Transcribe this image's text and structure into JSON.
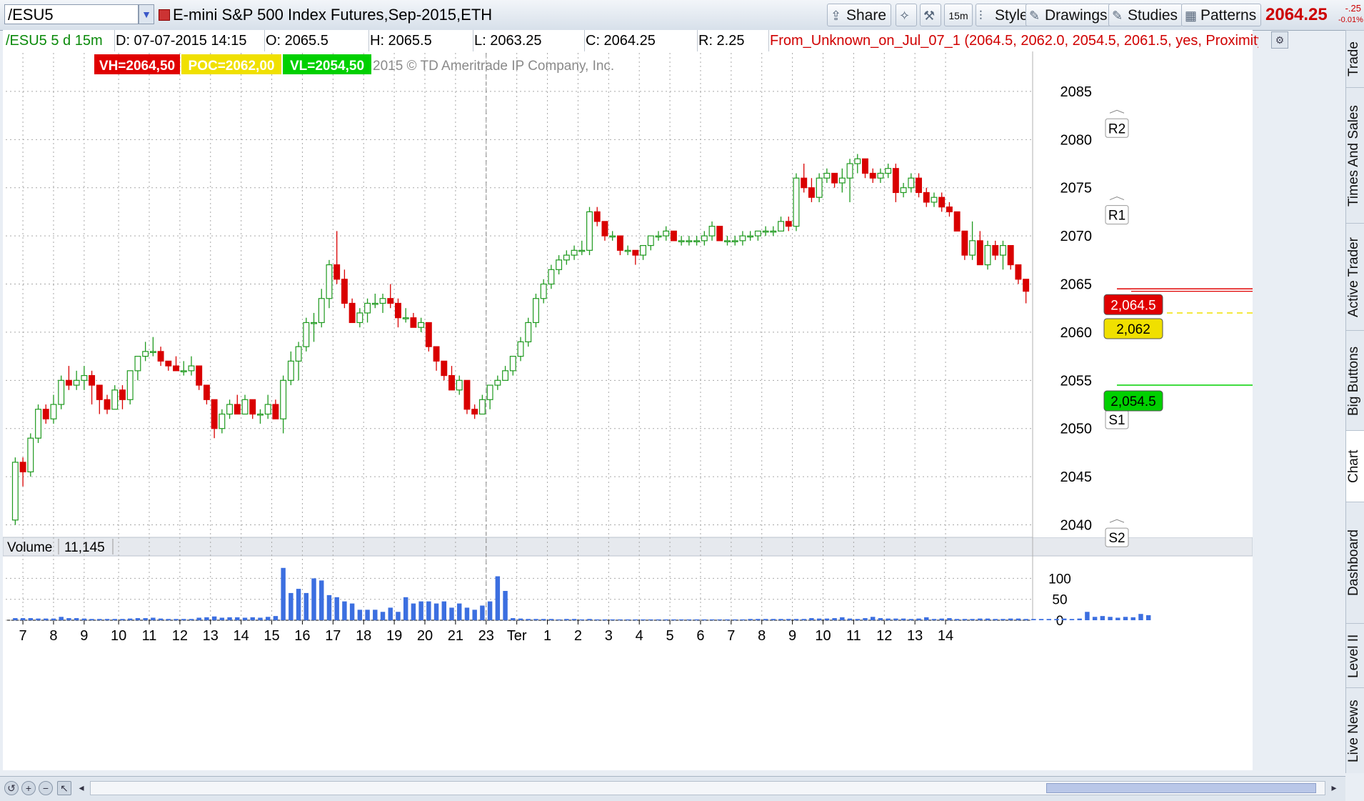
{
  "toolbar": {
    "symbol": "/ESU5",
    "title": "E-mini S&P 500 Index Futures,Sep-2015,ETH",
    "share": "Share",
    "timeframe": "15m",
    "style": "Style",
    "drawings": "Drawings",
    "studies": "Studies",
    "patterns": "Patterns",
    "last_price": "2064.25",
    "change": "-.25",
    "change_pct": "-0.01%"
  },
  "infobar": {
    "period": "/ESU5 5 d 15m",
    "date": "D: 07-07-2015 14:15",
    "open": "O: 2065.5",
    "high": "H: 2065.5",
    "low": "L: 2063.25",
    "close": "C: 2064.25",
    "range": "R: 2.25",
    "study": "From_Unknown_on_Jul_07_1 (2064.5, 2062.0, 2054.5, 2061.5, yes, Proximity, no, no, yes,..."
  },
  "overlay": {
    "vh": "VH=2064,50",
    "poc": "POC=2062,00",
    "vl": "VL=2054,50",
    "copyright": "2015 © TD Ameritrade IP Company, Inc."
  },
  "colors": {
    "up": "#1f9a1f",
    "down": "#d90000",
    "volume": "#3c6fe0",
    "vh": "#e00000",
    "poc": "#f0e000",
    "vl": "#00d000",
    "grid": "#a7a7a7"
  },
  "volume": {
    "label": "Volume",
    "value": "11,145",
    "unit": "<thousan..."
  },
  "sidetabs": [
    "Trade",
    "Times And Sales",
    "Active Trader",
    "Big Buttons",
    "Chart",
    "Dashboard",
    "Level II",
    "Live News"
  ],
  "chart_data": {
    "type": "candlestick",
    "ylim": [
      2039,
      2089
    ],
    "yticks": [
      2085,
      2080,
      2075,
      2070,
      2065,
      2060,
      2055,
      2050,
      2045,
      2040
    ],
    "price_marks": [
      {
        "label": "2082.75",
        "value": 2082.75,
        "color": "#ffffff",
        "text": "#000000"
      },
      {
        "label": "2073.75",
        "value": 2073.75,
        "color": "#ffffff",
        "text": "#000000"
      },
      {
        "label": "2064.25",
        "value": 2064.25,
        "color": "#e00000",
        "text": "#ffffff"
      },
      {
        "label": "2062",
        "value": 2062,
        "color": "#f0e000",
        "text": "#000000"
      },
      {
        "label": "2054.5",
        "value": 2054.5,
        "color": "#00d000",
        "text": "#000000"
      },
      {
        "label": "2052.5",
        "value": 2052.5,
        "color": "#ffffff",
        "text": "#000000"
      },
      {
        "label": "2040.25",
        "value": 2040.25,
        "color": "#ffffff",
        "text": "#000000"
      }
    ],
    "pivots": [
      {
        "label": "R2",
        "value": 2082.75
      },
      {
        "label": "R1",
        "value": 2073.75
      },
      {
        "label": "S1",
        "value": 2052.5
      },
      {
        "label": "S2",
        "value": 2040.25
      }
    ],
    "levels": [
      {
        "label": "2,064.5",
        "value": 2064.5,
        "color": "#e00000",
        "text": "#ffffff"
      },
      {
        "label": "2,062",
        "value": 2062,
        "color": "#f0e000",
        "text": "#000000"
      },
      {
        "label": "2,054.5",
        "value": 2054.5,
        "color": "#00d000",
        "text": "#000000"
      }
    ],
    "session_divider_index": 62,
    "x_labels": [
      {
        "label": "7",
        "index": 1
      },
      {
        "label": "8",
        "index": 5
      },
      {
        "label": "9",
        "index": 9
      },
      {
        "label": "10",
        "index": 13.5
      },
      {
        "label": "11",
        "index": 17.5
      },
      {
        "label": "12",
        "index": 21.5
      },
      {
        "label": "13",
        "index": 25.5
      },
      {
        "label": "14",
        "index": 29.5
      },
      {
        "label": "15",
        "index": 33.5
      },
      {
        "label": "16",
        "index": 37.5
      },
      {
        "label": "17",
        "index": 41.5
      },
      {
        "label": "18",
        "index": 45.5
      },
      {
        "label": "19",
        "index": 49.5
      },
      {
        "label": "20",
        "index": 53.5
      },
      {
        "label": "21",
        "index": 57.5
      },
      {
        "label": "23",
        "index": 61.5
      },
      {
        "label": "Ter",
        "index": 65.5
      },
      {
        "label": "1",
        "index": 69.5
      },
      {
        "label": "2",
        "index": 73.5
      },
      {
        "label": "3",
        "index": 77.5
      },
      {
        "label": "4",
        "index": 81.5
      },
      {
        "label": "5",
        "index": 85.5
      },
      {
        "label": "6",
        "index": 89.5
      },
      {
        "label": "7",
        "index": 93.5
      },
      {
        "label": "8",
        "index": 97.5
      },
      {
        "label": "9",
        "index": 101.5
      },
      {
        "label": "10",
        "index": 105.5
      },
      {
        "label": "11",
        "index": 109.5
      },
      {
        "label": "12",
        "index": 113.5
      },
      {
        "label": "13",
        "index": 117.5
      },
      {
        "label": "14",
        "index": 121.5
      }
    ],
    "volume_ylim": [
      0,
      140
    ],
    "volume_ticks": [
      100,
      50,
      0
    ],
    "candles": [
      [
        2040.5,
        2047.0,
        2040.0,
        2046.5
      ],
      [
        2046.5,
        2047.0,
        2044.0,
        2045.5
      ],
      [
        2045.5,
        2049.5,
        2045.0,
        2049.0
      ],
      [
        2049.0,
        2052.5,
        2048.5,
        2052.0
      ],
      [
        2052.0,
        2052.5,
        2050.5,
        2051.0
      ],
      [
        2051.0,
        2053.5,
        2050.5,
        2052.5
      ],
      [
        2052.5,
        2055.5,
        2052.0,
        2055.0
      ],
      [
        2055.0,
        2056.5,
        2054.0,
        2054.5
      ],
      [
        2054.5,
        2056.0,
        2054.0,
        2055.0
      ],
      [
        2055.0,
        2056.5,
        2054.0,
        2055.5
      ],
      [
        2055.5,
        2056.0,
        2052.5,
        2054.5
      ],
      [
        2054.5,
        2054.5,
        2051.5,
        2053.0
      ],
      [
        2053.0,
        2053.5,
        2051.5,
        2052.0
      ],
      [
        2052.0,
        2054.5,
        2052.0,
        2054.0
      ],
      [
        2054.0,
        2054.5,
        2052.0,
        2053.0
      ],
      [
        2053.0,
        2056.0,
        2052.5,
        2056.0
      ],
      [
        2056.0,
        2057.5,
        2055.0,
        2057.5
      ],
      [
        2057.5,
        2059.0,
        2057.0,
        2058.0
      ],
      [
        2058.0,
        2059.5,
        2057.5,
        2058.0
      ],
      [
        2058.0,
        2058.5,
        2056.5,
        2057.0
      ],
      [
        2057.0,
        2057.0,
        2056.0,
        2056.5
      ],
      [
        2056.5,
        2057.5,
        2056.0,
        2056.0
      ],
      [
        2056.0,
        2057.0,
        2055.5,
        2056.0
      ],
      [
        2056.0,
        2057.5,
        2055.5,
        2056.5
      ],
      [
        2056.5,
        2056.5,
        2054.0,
        2054.5
      ],
      [
        2054.5,
        2054.5,
        2052.5,
        2053.0
      ],
      [
        2053.0,
        2053.0,
        2049.0,
        2050.0
      ],
      [
        2050.0,
        2052.0,
        2049.5,
        2051.5
      ],
      [
        2051.5,
        2053.0,
        2051.0,
        2052.5
      ],
      [
        2052.5,
        2053.5,
        2051.5,
        2051.5
      ],
      [
        2051.5,
        2053.5,
        2051.5,
        2053.0
      ],
      [
        2053.0,
        2053.0,
        2051.0,
        2051.5
      ],
      [
        2051.5,
        2052.0,
        2050.5,
        2051.5
      ],
      [
        2051.5,
        2053.5,
        2051.0,
        2052.5
      ],
      [
        2052.5,
        2053.0,
        2051.0,
        2051.0
      ],
      [
        2051.0,
        2055.5,
        2049.5,
        2055.0
      ],
      [
        2055.0,
        2058.0,
        2054.5,
        2057.0
      ],
      [
        2057.0,
        2059.0,
        2055.0,
        2058.5
      ],
      [
        2058.5,
        2061.5,
        2058.0,
        2061.0
      ],
      [
        2061.0,
        2062.0,
        2059.0,
        2061.0
      ],
      [
        2061.0,
        2064.5,
        2060.5,
        2063.5
      ],
      [
        2063.5,
        2067.5,
        2062.5,
        2067.0
      ],
      [
        2067.0,
        2070.5,
        2065.0,
        2065.5
      ],
      [
        2065.5,
        2066.5,
        2062.5,
        2063.0
      ],
      [
        2063.0,
        2063.5,
        2061.0,
        2061.0
      ],
      [
        2061.0,
        2062.5,
        2060.5,
        2062.0
      ],
      [
        2062.0,
        2063.5,
        2061.0,
        2063.0
      ],
      [
        2063.0,
        2064.0,
        2062.5,
        2063.0
      ],
      [
        2063.0,
        2064.0,
        2062.0,
        2063.5
      ],
      [
        2063.5,
        2065.0,
        2062.5,
        2063.0
      ],
      [
        2063.0,
        2063.5,
        2060.5,
        2061.5
      ],
      [
        2061.5,
        2062.5,
        2061.0,
        2061.5
      ],
      [
        2061.5,
        2062.0,
        2060.5,
        2060.5
      ],
      [
        2060.5,
        2061.5,
        2060.0,
        2061.0
      ],
      [
        2061.0,
        2061.0,
        2058.0,
        2058.5
      ],
      [
        2058.5,
        2058.5,
        2056.0,
        2057.0
      ],
      [
        2057.0,
        2057.0,
        2055.0,
        2055.5
      ],
      [
        2055.5,
        2056.5,
        2054.0,
        2054.0
      ],
      [
        2054.0,
        2055.5,
        2053.5,
        2055.0
      ],
      [
        2055.0,
        2055.0,
        2051.5,
        2052.0
      ],
      [
        2052.0,
        2052.5,
        2051.0,
        2051.5
      ],
      [
        2051.5,
        2053.5,
        2051.5,
        2053.0
      ],
      [
        2053.0,
        2054.5,
        2052.0,
        2054.5
      ],
      [
        2054.5,
        2055.5,
        2054.0,
        2055.0
      ],
      [
        2055.0,
        2056.5,
        2055.0,
        2056.0
      ],
      [
        2056.0,
        2057.5,
        2055.5,
        2057.5
      ],
      [
        2057.5,
        2059.5,
        2057.0,
        2059.0
      ],
      [
        2059.0,
        2061.5,
        2058.5,
        2061.0
      ],
      [
        2061.0,
        2064.0,
        2060.5,
        2063.5
      ],
      [
        2063.5,
        2065.5,
        2063.0,
        2065.0
      ],
      [
        2065.0,
        2067.0,
        2064.5,
        2066.5
      ],
      [
        2066.5,
        2068.0,
        2066.0,
        2067.5
      ],
      [
        2067.5,
        2068.5,
        2067.0,
        2068.0
      ],
      [
        2068.0,
        2069.0,
        2067.5,
        2068.5
      ],
      [
        2068.5,
        2069.5,
        2068.0,
        2068.5
      ],
      [
        2068.5,
        2073.0,
        2068.0,
        2072.5
      ],
      [
        2072.5,
        2073.0,
        2071.0,
        2071.5
      ],
      [
        2071.5,
        2071.5,
        2069.5,
        2070.0
      ],
      [
        2070.0,
        2070.5,
        2069.5,
        2070.0
      ],
      [
        2070.0,
        2070.0,
        2068.0,
        2068.5
      ],
      [
        2068.5,
        2069.0,
        2068.0,
        2068.5
      ],
      [
        2068.5,
        2068.5,
        2067.0,
        2068.0
      ],
      [
        2068.0,
        2069.0,
        2067.5,
        2069.0
      ],
      [
        2069.0,
        2070.0,
        2068.5,
        2070.0
      ],
      [
        2070.0,
        2070.5,
        2069.5,
        2070.0
      ],
      [
        2070.0,
        2071.0,
        2069.5,
        2070.5
      ],
      [
        2070.5,
        2070.5,
        2069.5,
        2069.5
      ],
      [
        2069.5,
        2070.0,
        2069.0,
        2069.5
      ],
      [
        2069.5,
        2070.0,
        2069.0,
        2069.5
      ],
      [
        2069.5,
        2070.0,
        2069.0,
        2069.5
      ],
      [
        2069.5,
        2070.5,
        2069.0,
        2070.0
      ],
      [
        2070.0,
        2071.5,
        2069.5,
        2071.0
      ],
      [
        2071.0,
        2071.0,
        2069.5,
        2069.5
      ],
      [
        2069.5,
        2070.0,
        2069.0,
        2069.5
      ],
      [
        2069.5,
        2070.0,
        2069.0,
        2069.5
      ],
      [
        2069.5,
        2070.5,
        2069.0,
        2070.0
      ],
      [
        2070.0,
        2070.5,
        2069.5,
        2070.0
      ],
      [
        2070.0,
        2070.5,
        2069.5,
        2070.5
      ],
      [
        2070.5,
        2071.0,
        2070.0,
        2070.5
      ],
      [
        2070.5,
        2071.0,
        2070.0,
        2070.5
      ],
      [
        2070.5,
        2072.0,
        2070.5,
        2071.5
      ],
      [
        2071.5,
        2072.0,
        2070.5,
        2071.0
      ],
      [
        2071.0,
        2076.5,
        2070.5,
        2076.0
      ],
      [
        2076.0,
        2077.5,
        2074.5,
        2075.0
      ],
      [
        2075.0,
        2076.0,
        2073.5,
        2074.0
      ],
      [
        2074.0,
        2076.5,
        2073.5,
        2076.0
      ],
      [
        2076.0,
        2077.0,
        2075.5,
        2076.5
      ],
      [
        2076.5,
        2076.5,
        2075.0,
        2075.5
      ],
      [
        2075.5,
        2077.0,
        2074.5,
        2076.0
      ],
      [
        2076.0,
        2078.0,
        2073.5,
        2077.5
      ],
      [
        2077.5,
        2078.5,
        2076.5,
        2078.0
      ],
      [
        2078.0,
        2078.0,
        2076.0,
        2076.5
      ],
      [
        2076.5,
        2077.0,
        2075.5,
        2076.0
      ],
      [
        2076.0,
        2077.0,
        2075.5,
        2076.5
      ],
      [
        2076.5,
        2077.5,
        2076.0,
        2077.0
      ],
      [
        2077.0,
        2077.5,
        2073.5,
        2074.5
      ],
      [
        2074.5,
        2075.5,
        2074.0,
        2075.0
      ],
      [
        2075.0,
        2076.5,
        2074.5,
        2076.0
      ],
      [
        2076.0,
        2076.5,
        2074.0,
        2074.5
      ],
      [
        2074.5,
        2075.0,
        2073.0,
        2073.5
      ],
      [
        2073.5,
        2074.5,
        2073.0,
        2074.0
      ],
      [
        2074.0,
        2074.5,
        2072.5,
        2073.0
      ],
      [
        2073.0,
        2073.5,
        2072.0,
        2072.5
      ],
      [
        2072.5,
        2072.5,
        2070.5,
        2070.5
      ],
      [
        2070.5,
        2070.5,
        2067.5,
        2068.0
      ],
      [
        2068.0,
        2071.5,
        2067.5,
        2069.5
      ],
      [
        2069.5,
        2070.5,
        2067.0,
        2067.0
      ],
      [
        2067.0,
        2069.5,
        2066.5,
        2069.0
      ],
      [
        2069.0,
        2069.5,
        2067.5,
        2068.0
      ],
      [
        2068.0,
        2069.5,
        2066.5,
        2069.0
      ],
      [
        2069.0,
        2069.0,
        2066.5,
        2067.0
      ],
      [
        2067.0,
        2067.0,
        2065.0,
        2065.5
      ],
      [
        2065.5,
        2065.5,
        2063.0,
        2064.25
      ]
    ],
    "volumes": [
      5,
      5,
      5,
      4,
      4,
      4,
      8,
      5,
      5,
      4,
      3,
      3,
      3,
      3,
      3,
      4,
      5,
      5,
      6,
      4,
      3,
      3,
      3,
      3,
      6,
      7,
      9,
      6,
      7,
      7,
      6,
      7,
      6,
      8,
      10,
      125,
      65,
      75,
      65,
      100,
      95,
      60,
      55,
      45,
      40,
      25,
      25,
      25,
      20,
      30,
      20,
      55,
      40,
      45,
      45,
      40,
      45,
      30,
      40,
      30,
      25,
      35,
      45,
      105,
      70,
      5,
      4,
      3,
      3,
      3,
      3,
      2,
      3,
      3,
      2,
      3,
      2,
      2,
      2,
      2,
      2,
      2,
      2,
      2,
      2,
      2,
      2,
      2,
      2,
      2,
      2,
      2,
      2,
      2,
      2,
      2,
      3,
      3,
      3,
      3,
      3,
      3,
      3,
      3,
      5,
      4,
      4,
      5,
      7,
      4,
      3,
      5,
      8,
      5,
      4,
      4,
      4,
      3,
      4,
      7,
      3,
      4,
      5,
      3,
      3,
      3,
      4,
      4,
      3,
      3,
      4,
      4,
      3,
      3,
      3,
      3,
      3,
      4,
      3,
      4,
      20,
      8,
      10,
      8,
      6,
      8,
      7,
      15,
      12
    ]
  }
}
